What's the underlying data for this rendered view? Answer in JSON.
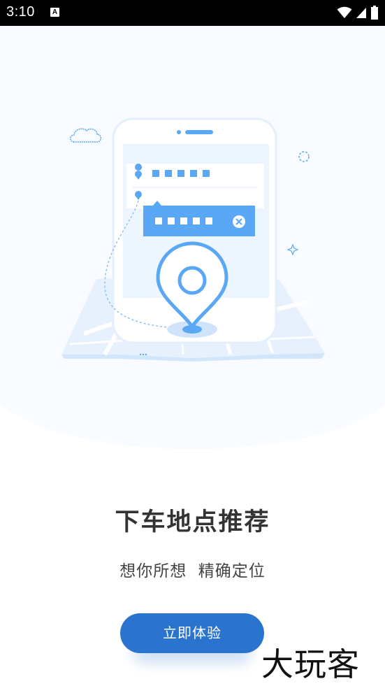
{
  "status_bar": {
    "time": "3:10",
    "notification_icon": "A",
    "icons": [
      "wifi-icon",
      "signal-icon",
      "battery-icon"
    ]
  },
  "illustration": {
    "semantic": "phone-with-map-and-location-pin",
    "icons": [
      "cloud-icon",
      "ring-icon",
      "sparkle-icon",
      "location-pin-icon",
      "close-circle-icon"
    ]
  },
  "onboarding": {
    "title": "下车地点推荐",
    "subtitle": "想你所想  精确定位",
    "cta_label": "立即体验"
  },
  "watermark": "大玩客",
  "colors": {
    "primary": "#2a74cf",
    "accent_light": "#5aa8f5",
    "hero_bg": "#f8fbff",
    "title": "#333333"
  }
}
